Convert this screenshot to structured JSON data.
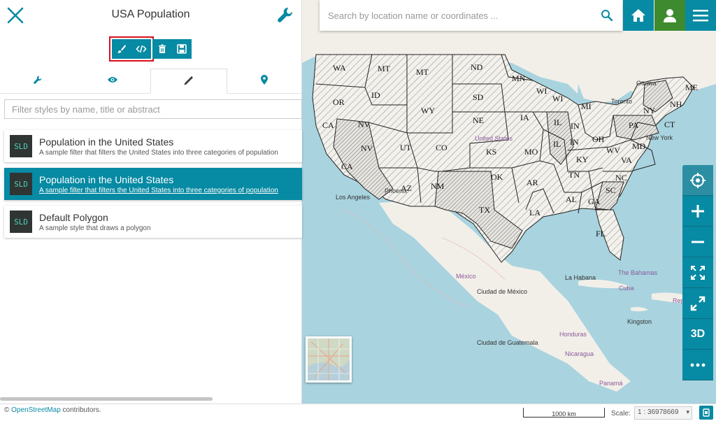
{
  "panel": {
    "title": "USA Population",
    "filter_placeholder": "Filter styles by name, title or abstract",
    "tabs": [
      {
        "name": "tab-settings",
        "icon": "wrench-icon"
      },
      {
        "name": "tab-preview",
        "icon": "eye-icon"
      },
      {
        "name": "tab-style",
        "icon": "dropper-icon"
      },
      {
        "name": "tab-position",
        "icon": "pin-icon"
      }
    ],
    "styles": [
      {
        "badge": "SLD",
        "title": "Population in the United States",
        "abstract": "A sample filter that filters the United States into three categories of population",
        "selected": false
      },
      {
        "badge": "SLD",
        "title": "Population in the United States",
        "abstract": "A sample filter that filters the United States into three categories of population",
        "selected": true
      },
      {
        "badge": "SLD",
        "title": "Default Polygon",
        "abstract": "A sample style that draws a polygon",
        "selected": false
      }
    ]
  },
  "search": {
    "placeholder": "Search by location name or coordinates ..."
  },
  "side_tools": {
    "three_d_label": "3D"
  },
  "map_labels": {
    "states": [
      "WA",
      "MT",
      "MT",
      "ND",
      "MN",
      "OR",
      "ID",
      "SD",
      "WI",
      "WI",
      "MI",
      "NY",
      "NH",
      "ME",
      "CA",
      "NV",
      "WY",
      "NE",
      "IA",
      "PA",
      "CT",
      "IL",
      "IN",
      "OH",
      "NV",
      "UT",
      "CO",
      "KS",
      "MO",
      "IL",
      "IN",
      "WV",
      "MD",
      "CA",
      "KY",
      "VA",
      "TN",
      "NC",
      "OK",
      "AR",
      "AZ",
      "NM",
      "SC",
      "AL",
      "GA",
      "TX",
      "LA",
      "FL"
    ],
    "places": [
      "Ottawa",
      "Toronto",
      "New York",
      "Los Angeles",
      "Phoenix",
      "United States",
      "México",
      "The Bahamas",
      "La Habana",
      "Cuba",
      "Ciudad de México",
      "Kingston",
      "Honduras",
      "Ciudad de Guatemala",
      "Nicaragua",
      "Panamá",
      "Rep. Dom."
    ]
  },
  "footer": {
    "attribution_prefix": "©",
    "attribution_link": "OpenStreetMap",
    "attribution_suffix": "contributors.",
    "scalebar": "1000 km",
    "scale_label": "Scale:",
    "scale_value": "1 : 36978669"
  },
  "colors": {
    "accent": "#078aa3",
    "user": "#3e8a2f",
    "highlight": "#d8111c",
    "water": "#a9d3df",
    "land": "#f2efe9"
  }
}
